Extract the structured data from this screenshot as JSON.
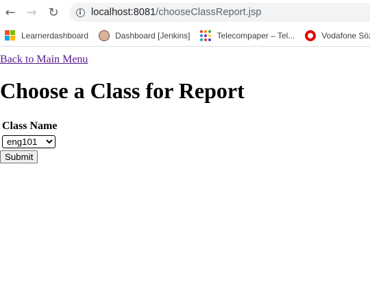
{
  "browser": {
    "url_host": "localhost:8081",
    "url_path": "/chooseClassReport.jsp",
    "bookmarks": [
      {
        "label": "Learnerdashboard",
        "icon": "microsoft-logo-icon"
      },
      {
        "label": "Dashboard [Jenkins]",
        "icon": "jenkins-logo-icon"
      },
      {
        "label": "Telecompaper – Tel...",
        "icon": "telecompaper-logo-icon"
      },
      {
        "label": "Vodafone Sözl",
        "icon": "vodafone-logo-icon"
      }
    ]
  },
  "page": {
    "back_link": "Back to Main Menu",
    "title": "Choose a Class for Report",
    "form": {
      "class_name_header": "Class Name",
      "selected_class": "eng101",
      "submit_label": "Submit"
    }
  }
}
